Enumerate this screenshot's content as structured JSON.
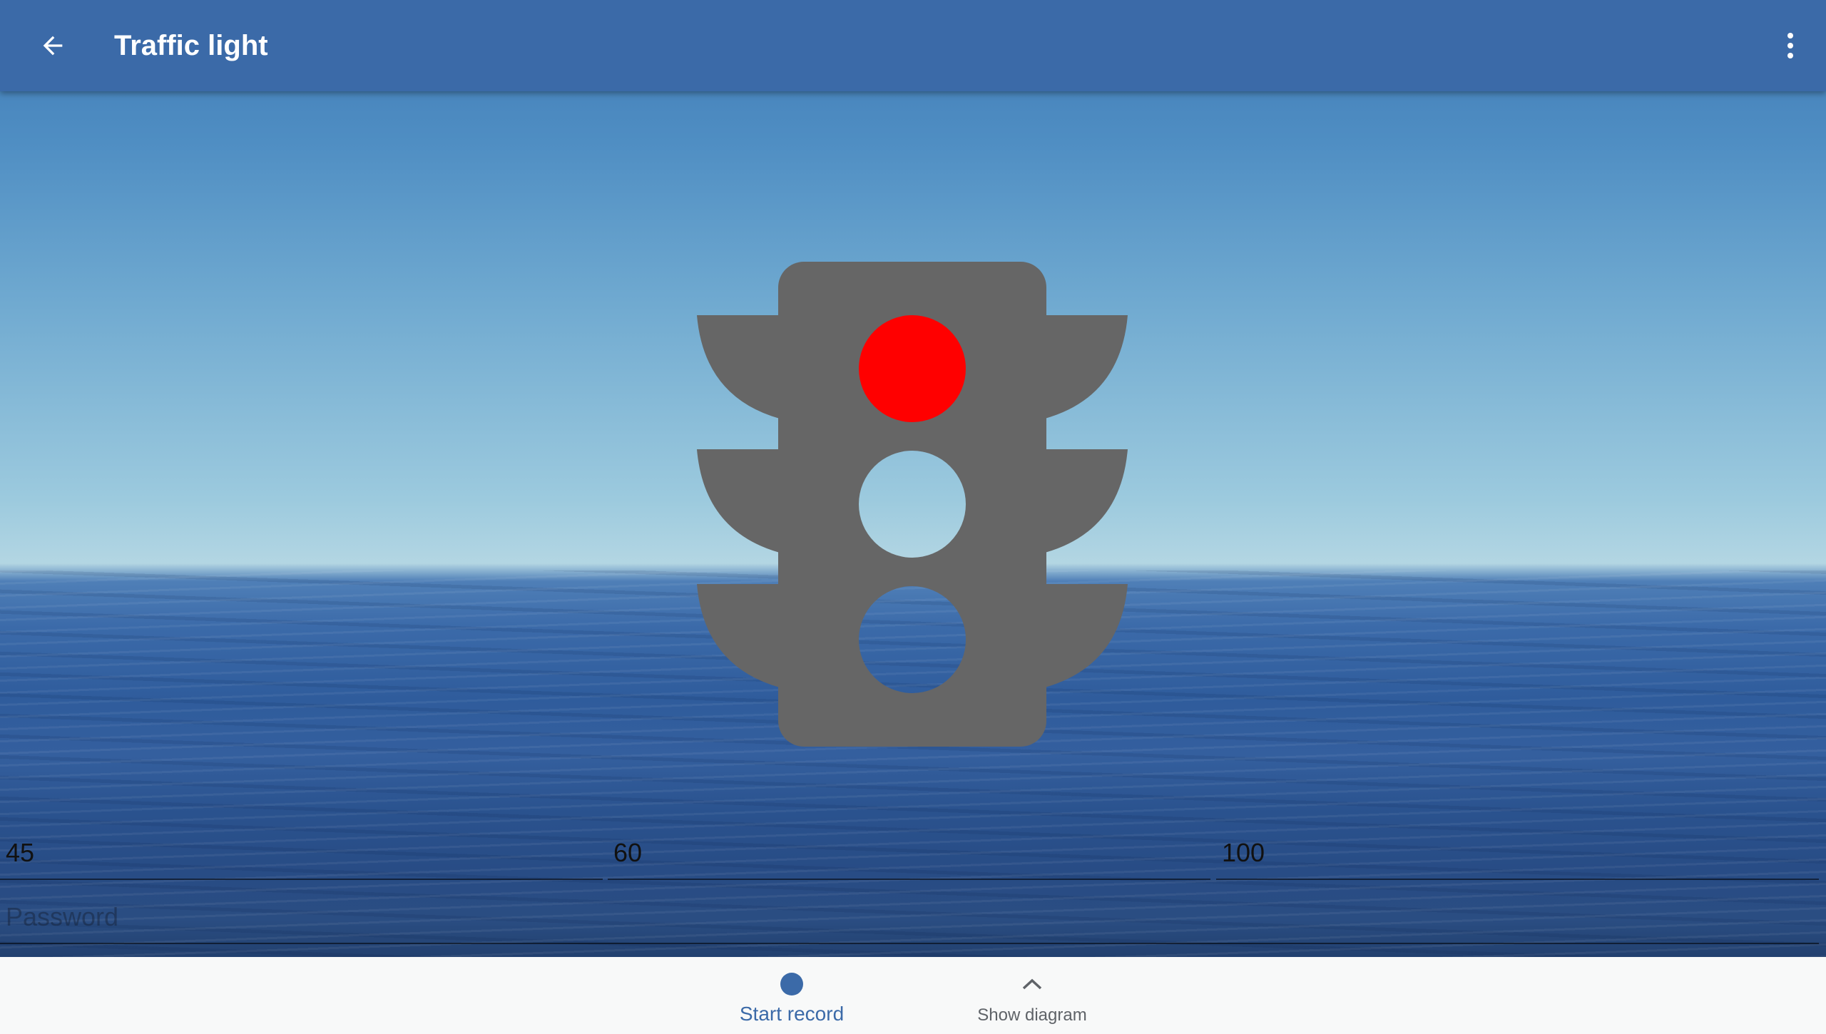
{
  "app_bar": {
    "title": "Traffic light",
    "back_icon": "arrow-back-icon",
    "menu_icon": "more-vert-icon",
    "background_color": "#3b6aa8"
  },
  "traffic_light": {
    "body_color": "#666666",
    "active_color": "#ff0000",
    "inactive_color": "transparent",
    "lights": [
      {
        "name": "red",
        "on": true
      },
      {
        "name": "yellow",
        "on": false
      },
      {
        "name": "green",
        "on": false
      }
    ]
  },
  "inputs": {
    "values": [
      "45",
      "60",
      "100"
    ],
    "password_placeholder": "Password"
  },
  "bottom_nav": {
    "start_record": {
      "label": "Start record",
      "icon": "record-dot-icon",
      "color": "#3b6aa8"
    },
    "show_diagram": {
      "label": "Show diagram",
      "icon": "chevron-up-icon"
    }
  }
}
